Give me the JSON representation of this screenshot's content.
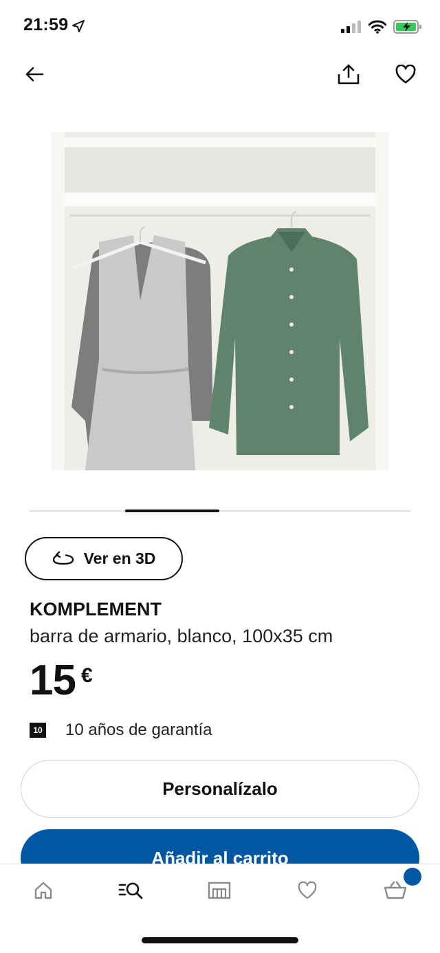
{
  "status_bar": {
    "time": "21:59",
    "icons": [
      "location-arrow-icon",
      "cellular-signal-icon",
      "wifi-icon",
      "battery-charging-icon"
    ]
  },
  "header": {
    "back_icon": "arrow-left-icon",
    "share_icon": "share-icon",
    "favorite_icon": "heart-icon"
  },
  "gallery": {
    "image": "product-photo",
    "carousel_position": 0.25
  },
  "view3d": {
    "label": "Ver en 3D",
    "icon": "rotate-3d-icon"
  },
  "product": {
    "name": "KOMPLEMENT",
    "description": "barra de armario, blanco, 100x35 cm",
    "price_integer": "15",
    "price_currency": "€",
    "warranty_badge": "10",
    "warranty_text": "10 años de garantía"
  },
  "actions": {
    "customize_label": "Personalízalo",
    "add_to_cart_label": "Añadir al carrito"
  },
  "bottom_nav": {
    "items": [
      "home-icon",
      "search-icon",
      "store-icon",
      "heart-icon",
      "cart-icon"
    ],
    "active": "search-icon",
    "cart_badge_color": "#0058a3"
  },
  "colors": {
    "brand_blue": "#0058a3",
    "text": "#111111"
  }
}
